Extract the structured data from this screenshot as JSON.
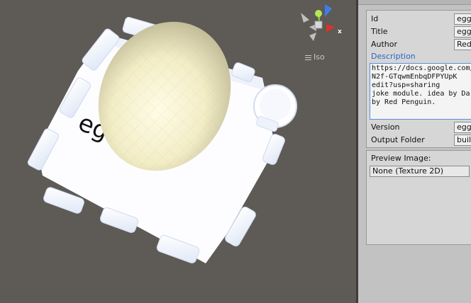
{
  "scene": {
    "projection_label": "Iso",
    "gizmo_axis_x": "x",
    "model_text": "eg   e :)",
    "colors": {
      "background": "#5e5a55",
      "egg": "#f3edc6",
      "board": "#ffffff"
    }
  },
  "inspector": {
    "fields": [
      {
        "label": "Id",
        "value": "egg"
      },
      {
        "label": "Title",
        "value": "egg"
      },
      {
        "label": "Author",
        "value": "Red"
      }
    ],
    "description": {
      "label": "Description",
      "lines": [
        "https://docs.google.com/",
        "N2f-GTqwmEnbqDFPYUpK",
        "edit?usp=sharing",
        "joke module. idea by Da",
        "by Red Penguin."
      ]
    },
    "bottom_fields": [
      {
        "label": "Version",
        "value": "egg"
      },
      {
        "label": "Output Folder",
        "value": "buil"
      }
    ],
    "preview": {
      "label": "Preview Image:",
      "value": "None (Texture 2D)"
    }
  }
}
